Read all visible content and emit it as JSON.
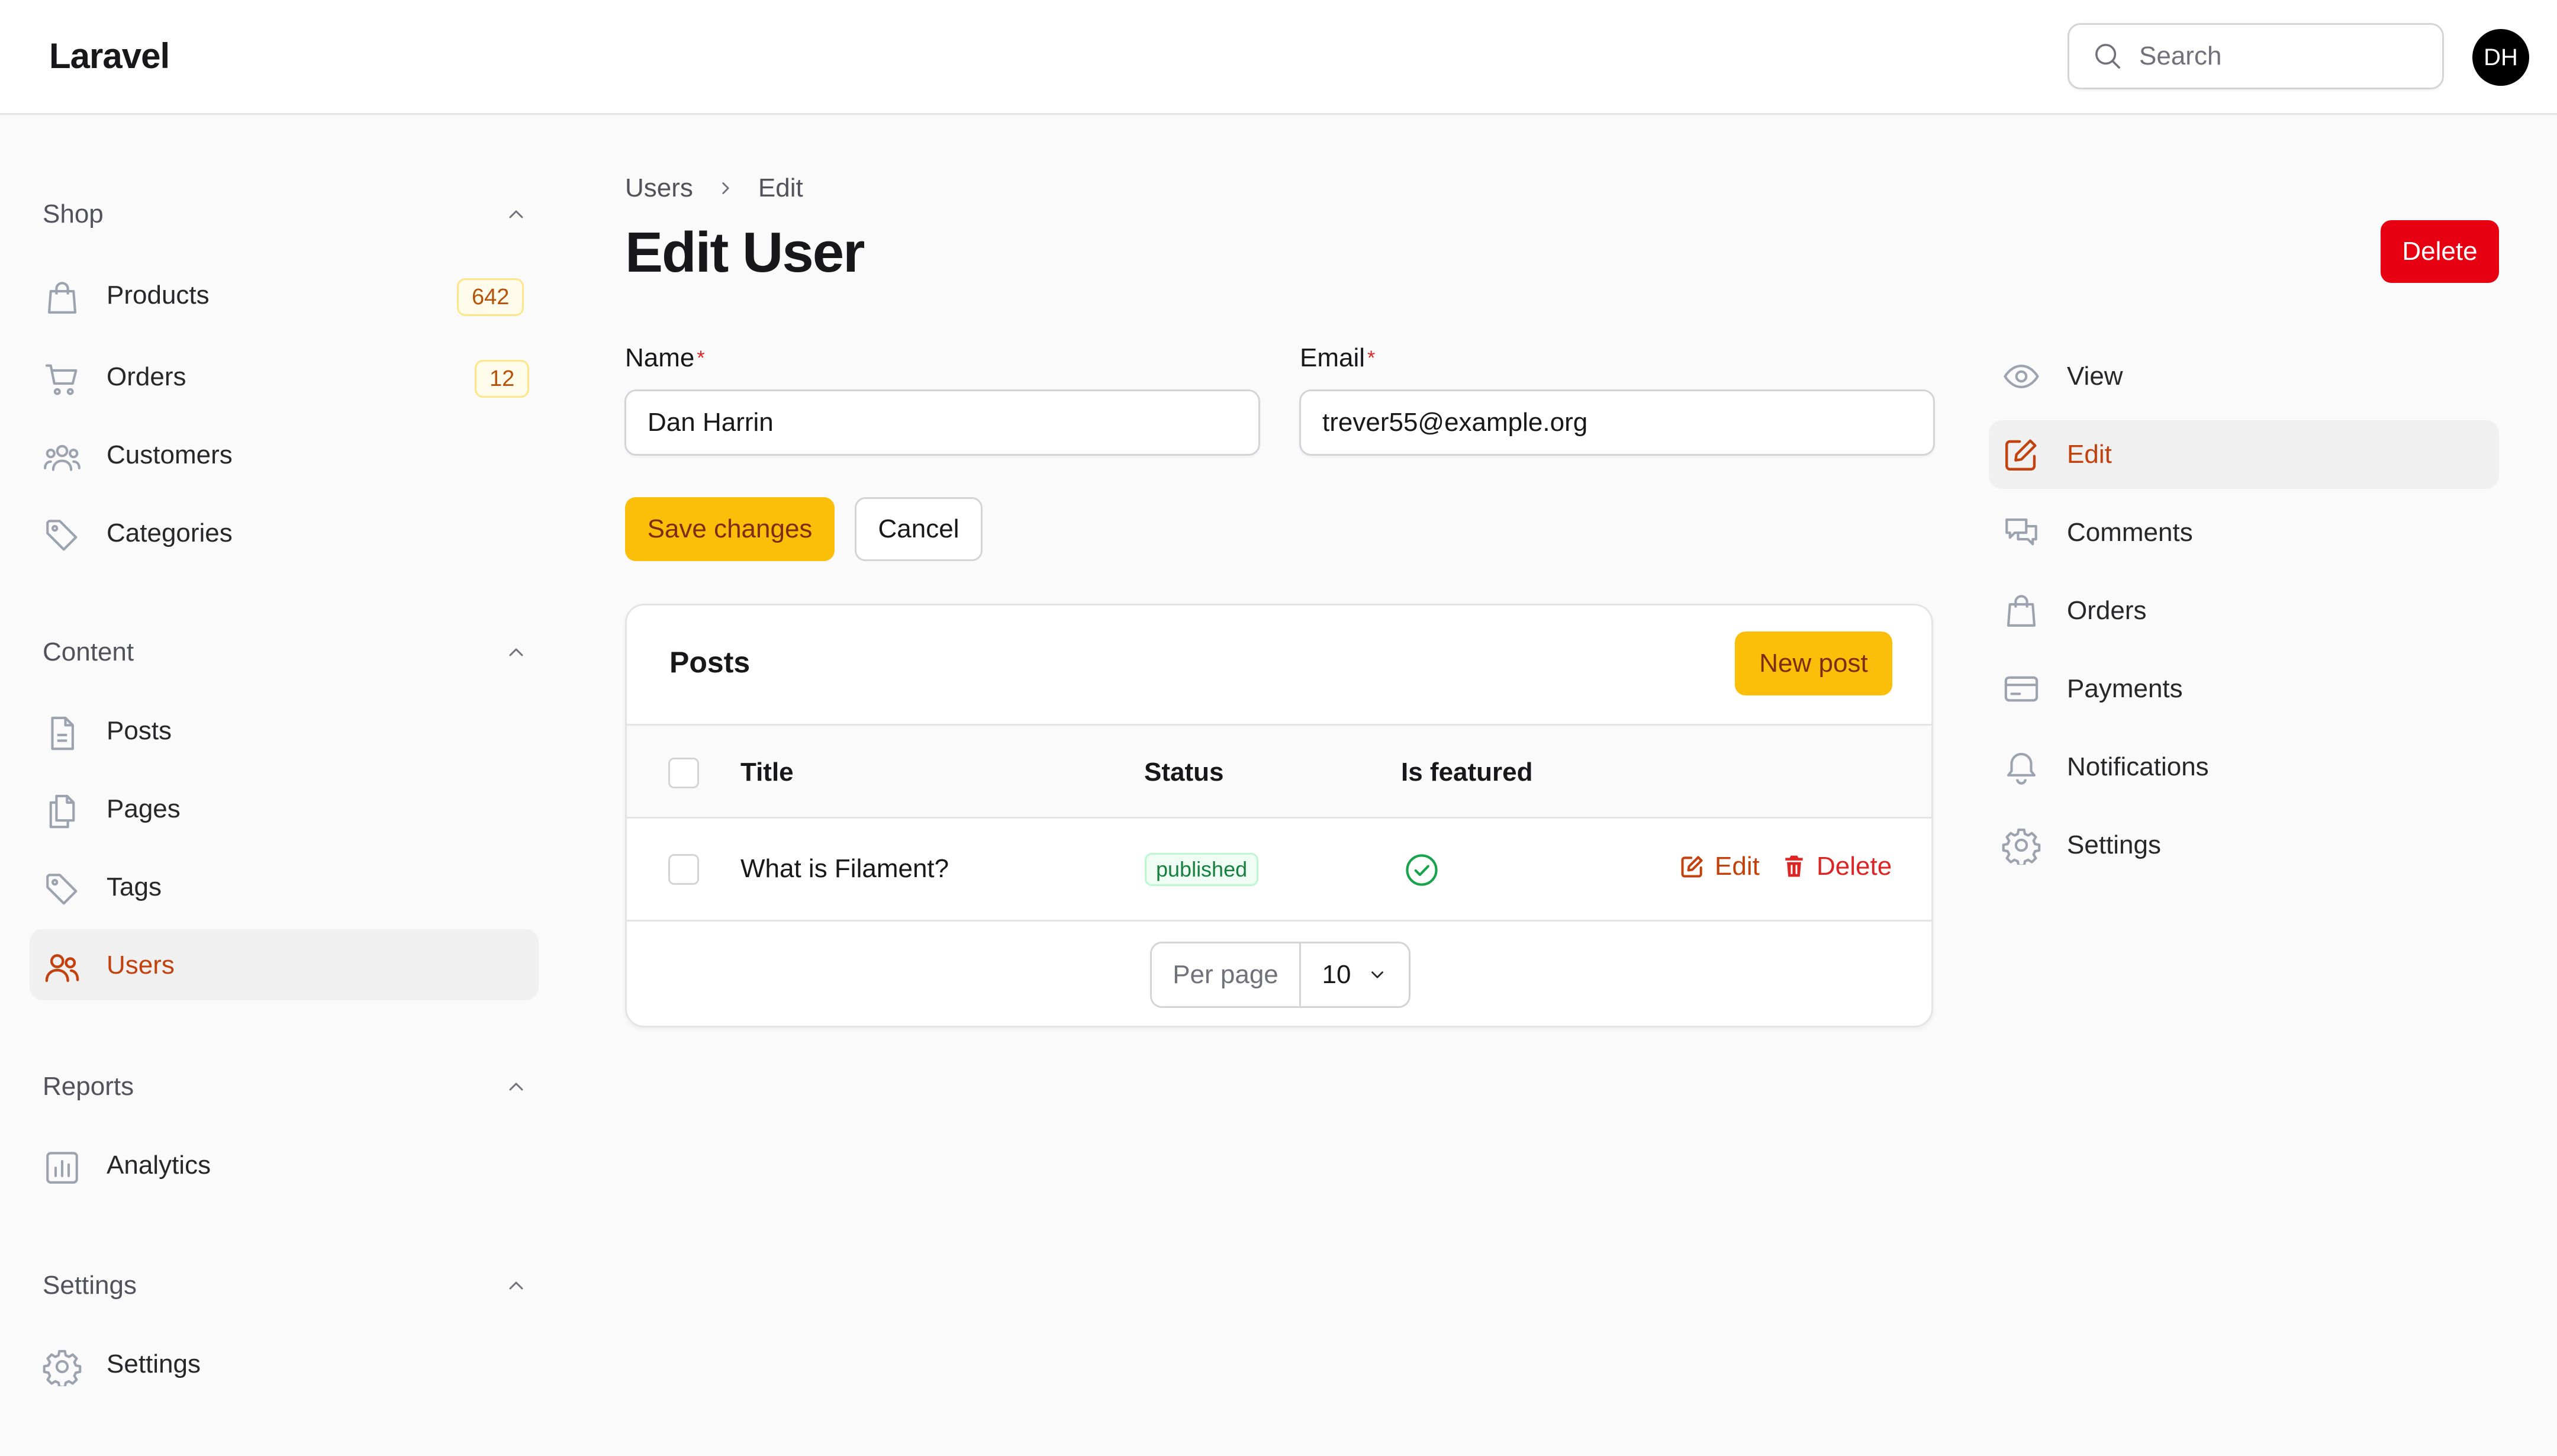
{
  "header": {
    "brand": "Laravel",
    "search_placeholder": "Search",
    "avatar_initials": "DH"
  },
  "sidebar": {
    "groups": [
      {
        "label": "Shop",
        "items": [
          {
            "label": "Products",
            "icon": "shopping-bag-icon",
            "badge": "642"
          },
          {
            "label": "Orders",
            "icon": "shopping-cart-icon",
            "badge": "12"
          },
          {
            "label": "Customers",
            "icon": "user-group-icon"
          },
          {
            "label": "Categories",
            "icon": "tag-icon"
          }
        ]
      },
      {
        "label": "Content",
        "items": [
          {
            "label": "Posts",
            "icon": "document-icon"
          },
          {
            "label": "Pages",
            "icon": "documents-icon"
          },
          {
            "label": "Tags",
            "icon": "tag-icon"
          },
          {
            "label": "Users",
            "icon": "users-icon",
            "active": true
          }
        ]
      },
      {
        "label": "Reports",
        "items": [
          {
            "label": "Analytics",
            "icon": "chart-bar-icon"
          }
        ]
      },
      {
        "label": "Settings",
        "items": [
          {
            "label": "Settings",
            "icon": "cog-icon"
          }
        ]
      }
    ]
  },
  "breadcrumb": {
    "items": [
      "Users",
      "Edit"
    ]
  },
  "page": {
    "title": "Edit User",
    "delete_label": "Delete"
  },
  "form": {
    "name_label": "Name",
    "name_value": "Dan Harrin",
    "email_label": "Email",
    "email_value": "trever55@example.org",
    "required_marker": "*",
    "save_label": "Save changes",
    "cancel_label": "Cancel"
  },
  "posts": {
    "title": "Posts",
    "new_label": "New post",
    "columns": [
      "Title",
      "Status",
      "Is featured"
    ],
    "rows": [
      {
        "title": "What is Filament?",
        "status": "published",
        "featured": true
      }
    ],
    "edit_label": "Edit",
    "delete_label": "Delete",
    "per_page_label": "Per page",
    "per_page_value": "10"
  },
  "subnav": {
    "items": [
      {
        "label": "View",
        "icon": "eye-icon"
      },
      {
        "label": "Edit",
        "icon": "pencil-square-icon",
        "active": true
      },
      {
        "label": "Comments",
        "icon": "chat-bubbles-icon"
      },
      {
        "label": "Orders",
        "icon": "shopping-bag-icon"
      },
      {
        "label": "Payments",
        "icon": "credit-card-icon"
      },
      {
        "label": "Notifications",
        "icon": "bell-icon"
      },
      {
        "label": "Settings",
        "icon": "cog-icon"
      }
    ]
  },
  "colors": {
    "primary": "#fbbf0a",
    "danger": "#e60012",
    "active_text": "#c2410c",
    "success": "#16a34a"
  }
}
